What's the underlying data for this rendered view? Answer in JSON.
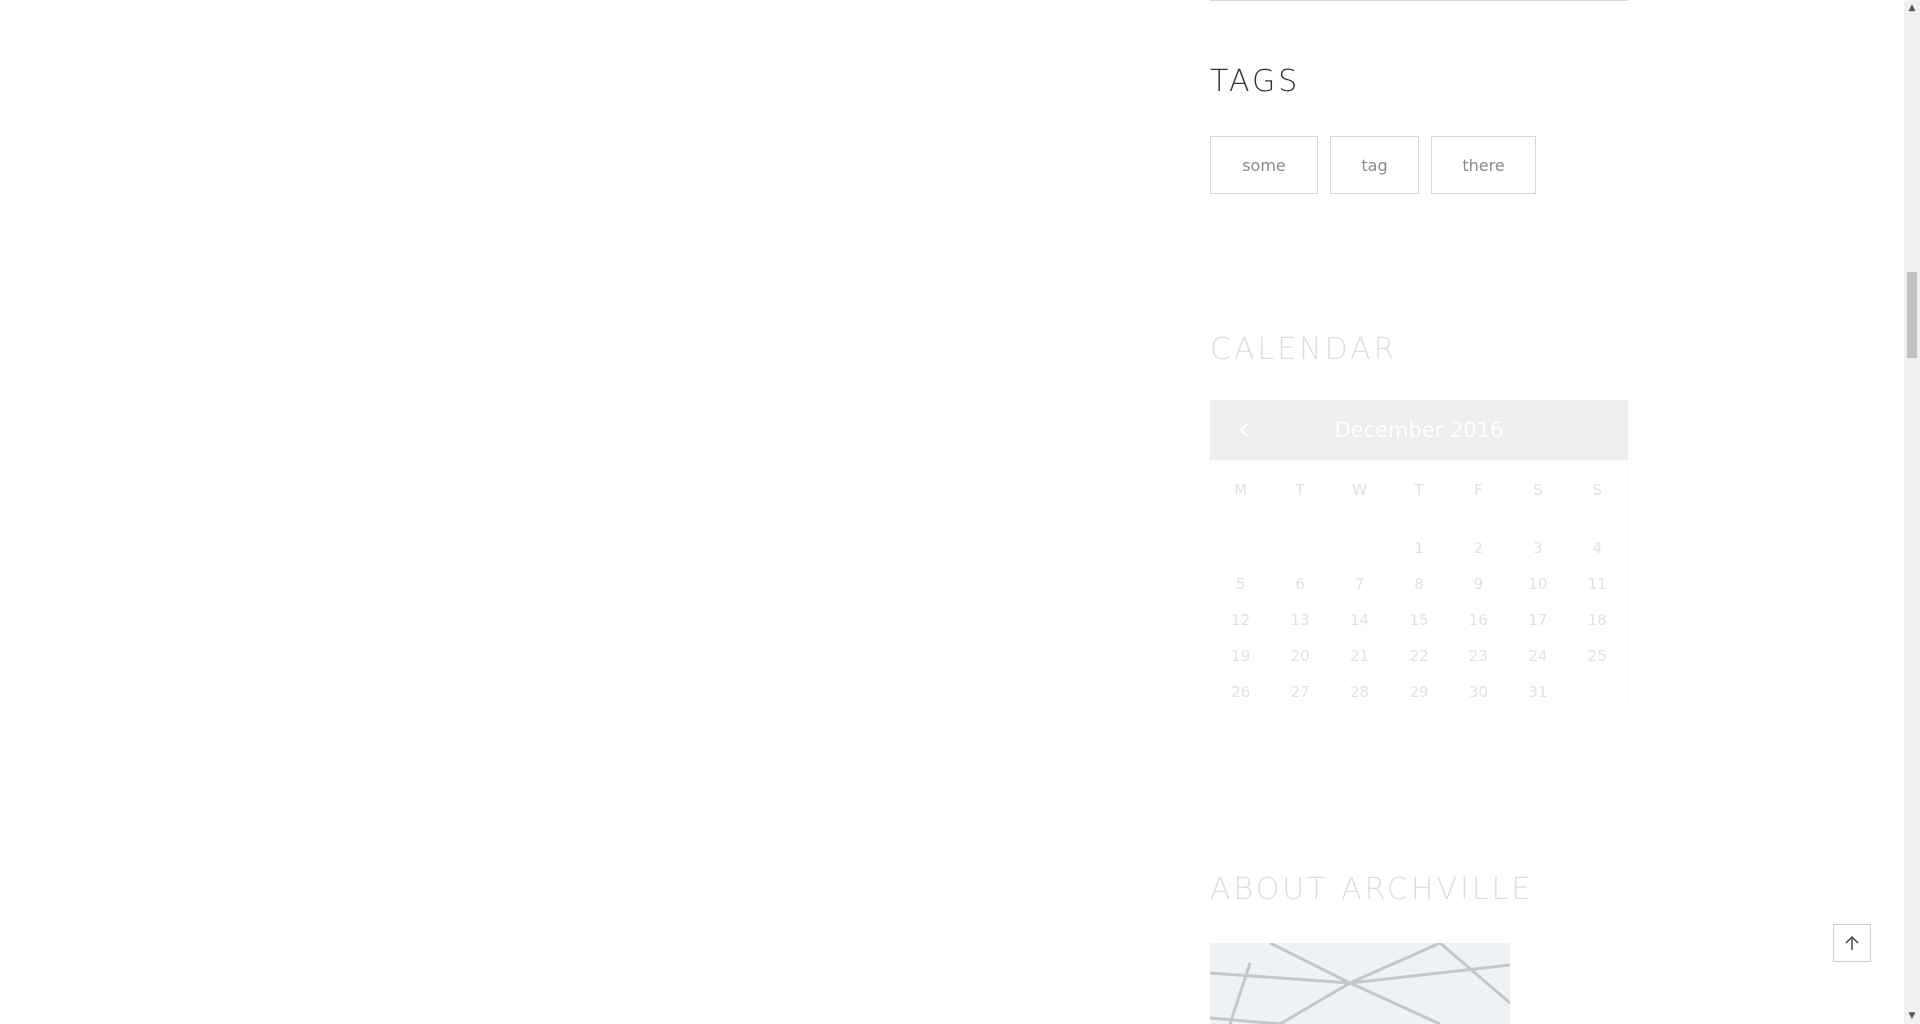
{
  "tags_widget": {
    "title": "TAGS",
    "tags": [
      "some",
      "tag",
      "there"
    ]
  },
  "calendar_widget": {
    "title": "CALENDAR",
    "month_label": "December 2016",
    "weekdays": [
      "M",
      "T",
      "W",
      "T",
      "F",
      "S",
      "S"
    ],
    "weeks": [
      [
        "",
        "",
        "",
        "1",
        "2",
        "3",
        "4"
      ],
      [
        "5",
        "6",
        "7",
        "8",
        "9",
        "10",
        "11"
      ],
      [
        "12",
        "13",
        "14",
        "15",
        "16",
        "17",
        "18"
      ],
      [
        "19",
        "20",
        "21",
        "22",
        "23",
        "24",
        "25"
      ],
      [
        "26",
        "27",
        "28",
        "29",
        "30",
        "31",
        ""
      ]
    ]
  },
  "about_widget": {
    "title": "ABOUT ARCHVILLE"
  },
  "icons": {
    "prev_month": "chevron-left-icon",
    "scroll_top": "arrow-up-icon"
  }
}
